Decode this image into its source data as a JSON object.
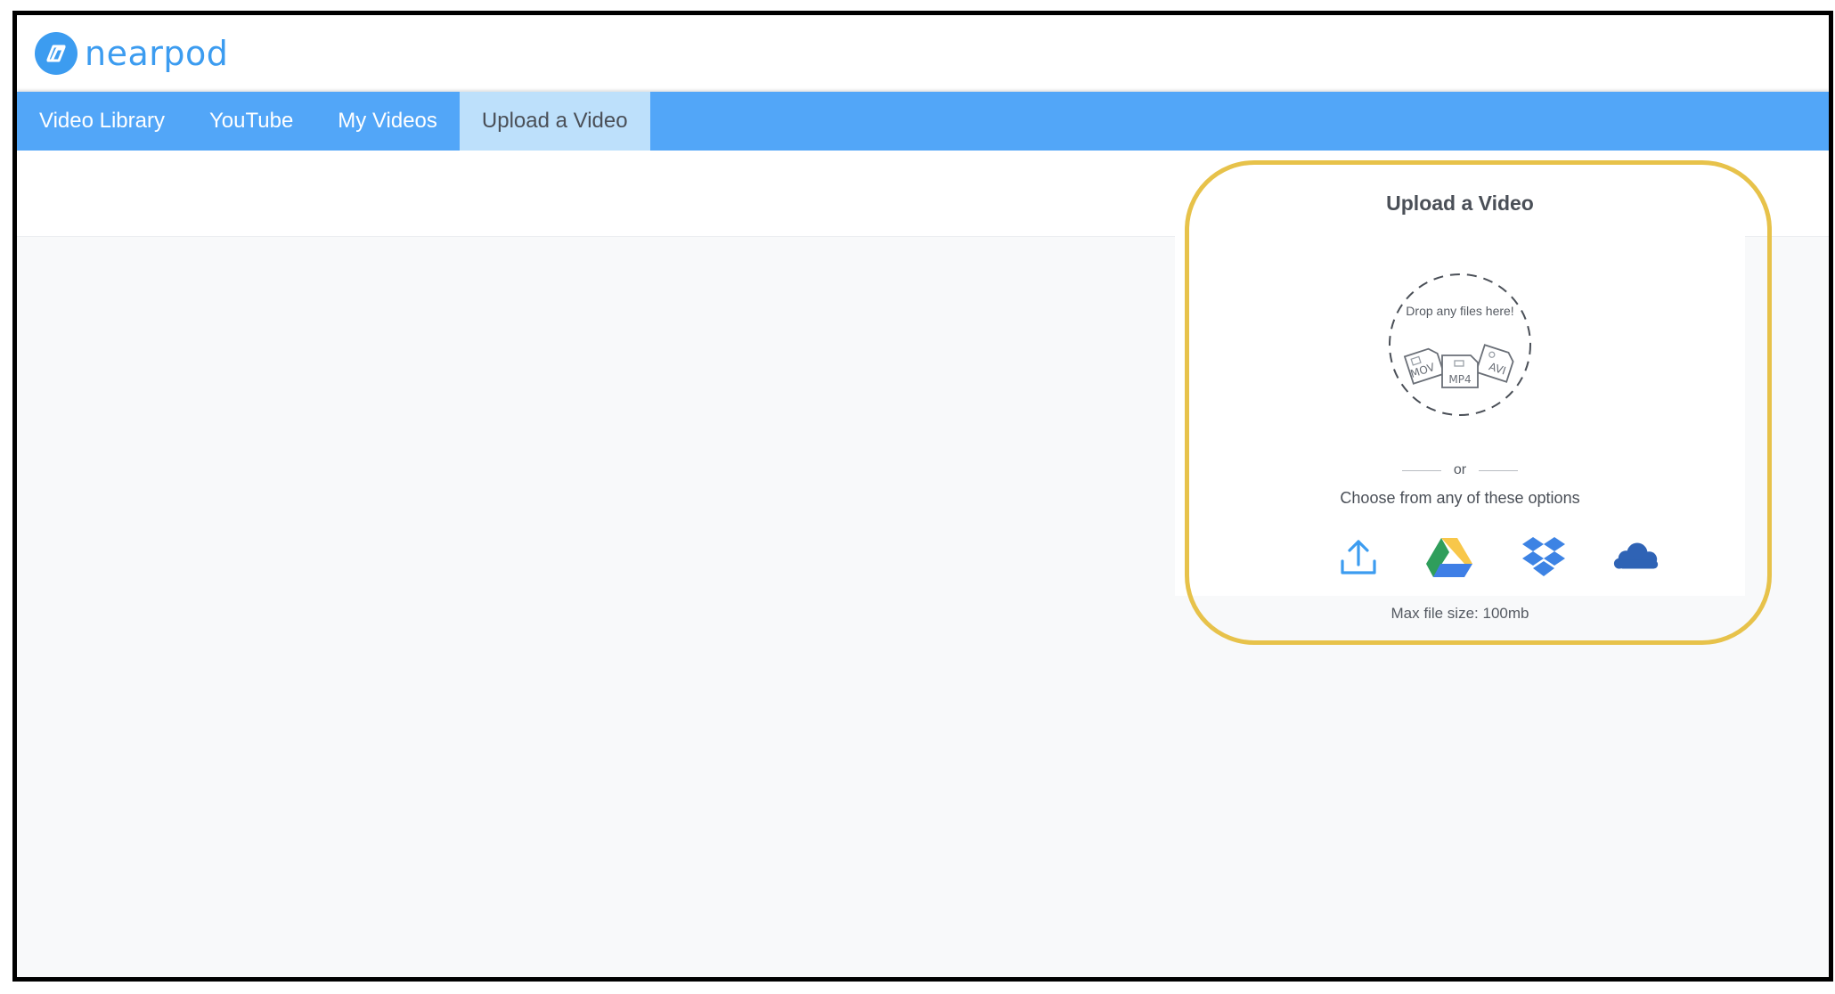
{
  "app": {
    "logo_text": "nearpod",
    "brand_color": "#3c9cf0"
  },
  "tabs": [
    {
      "label": "Video Library",
      "active": false
    },
    {
      "label": "YouTube",
      "active": false
    },
    {
      "label": "My Videos",
      "active": false
    },
    {
      "label": "Upload a Video",
      "active": true
    }
  ],
  "upload": {
    "title": "Upload a Video",
    "drop_text": "Drop any files here!",
    "file_types": [
      "MOV",
      "MP4",
      "AVI"
    ],
    "or_text": "or",
    "options_label": "Choose from any of these options",
    "options": [
      {
        "name": "upload-from-computer",
        "icon": "upload-icon"
      },
      {
        "name": "google-drive",
        "icon": "google-drive-icon"
      },
      {
        "name": "dropbox",
        "icon": "dropbox-icon"
      },
      {
        "name": "onedrive",
        "icon": "onedrive-icon"
      }
    ],
    "max_size": "Max file size: 100mb"
  },
  "colors": {
    "tab_bar": "#52a6f8",
    "tab_active": "#bde0fb",
    "highlight": "#e7c24a",
    "upload_icon": "#3c9cf0",
    "dropbox": "#3d83e4",
    "onedrive": "#2f63b5"
  }
}
